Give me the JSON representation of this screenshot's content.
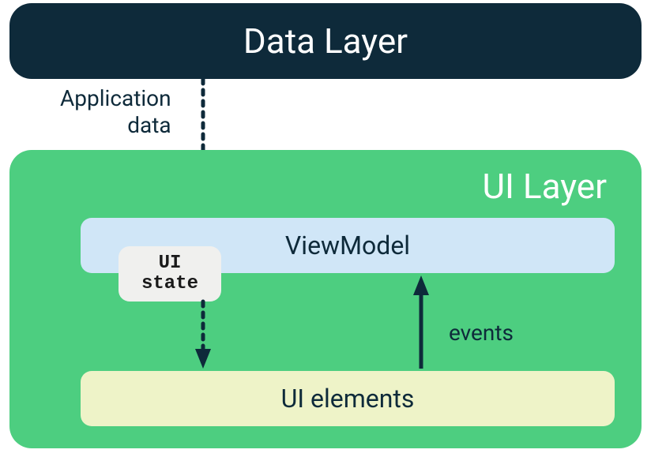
{
  "dataLayer": {
    "title": "Data Layer"
  },
  "labels": {
    "applicationData": "Application\ndata",
    "events": "events"
  },
  "uiLayer": {
    "title": "UI Layer",
    "viewModel": "ViewModel",
    "uiState": "UI\nstate",
    "uiElements": "UI elements"
  },
  "colors": {
    "darkNavy": "#0e2a3a",
    "green": "#4dce80",
    "lightBlue": "#d0e6f7",
    "lightYellow": "#eef3c8",
    "lightGray": "#f0f0ee"
  }
}
